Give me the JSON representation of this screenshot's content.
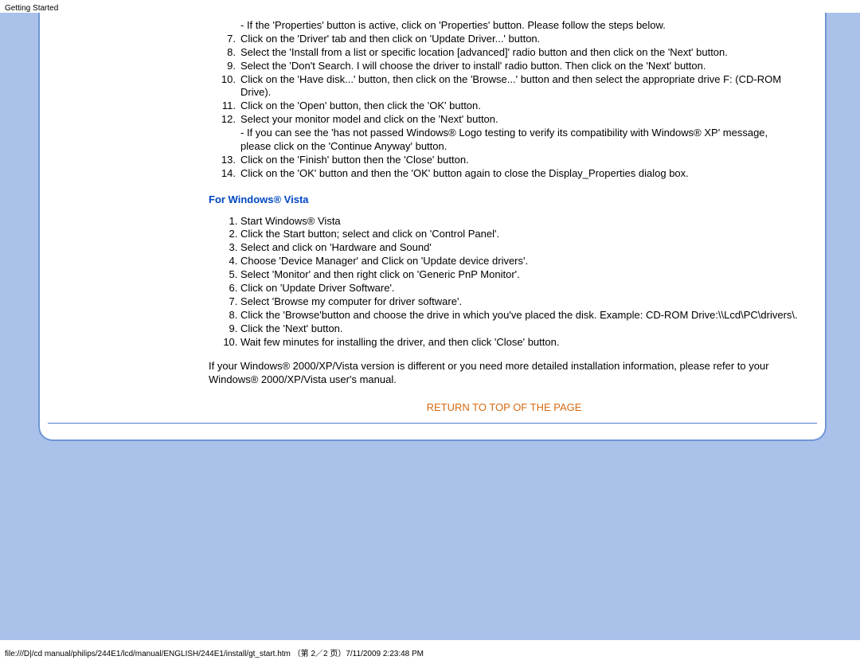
{
  "browser_title": "Getting Started",
  "xp_continue": [
    {
      "n": "",
      "txt": "- If the 'Properties' button is active, click on 'Properties' button. Please follow the steps below."
    },
    {
      "n": "7.",
      "txt": "Click on the 'Driver' tab and then click on 'Update Driver...' button."
    },
    {
      "n": "8.",
      "txt": "Select the 'Install from a list or specific location [advanced]' radio button and then click on the 'Next' button."
    },
    {
      "n": "9.",
      "txt": "Select the 'Don't Search. I will choose the driver to install' radio button. Then click on the 'Next' button."
    },
    {
      "n": "10.",
      "txt": "Click on the 'Have disk...' button, then click on the 'Browse...' button and then select the appropriate drive F: (CD-ROM Drive)."
    },
    {
      "n": "11.",
      "txt": "Click on the 'Open' button, then click the 'OK' button."
    },
    {
      "n": "12.",
      "txt": "Select your monitor model and click on the 'Next' button."
    },
    {
      "n": "",
      "txt": "- If you can see the 'has not passed Windows® Logo testing to verify its compatibility with Windows® XP' message, please click on the 'Continue Anyway' button."
    },
    {
      "n": "13.",
      "txt": "Click on the 'Finish' button then the 'Close' button."
    },
    {
      "n": "14.",
      "txt": "Click on the 'OK' button and then the 'OK' button again to close the Display_Properties dialog box."
    }
  ],
  "vista_heading": "For Windows® Vista",
  "vista_steps": [
    "Start Windows® Vista",
    "Click the Start button; select and click on 'Control Panel'.",
    "Select and click on 'Hardware and Sound'",
    "Choose 'Device Manager' and Click on 'Update device drivers'.",
    "Select 'Monitor' and then right click on 'Generic PnP Monitor'.",
    "Click on 'Update Driver Software'.",
    "Select 'Browse my computer for driver software'.",
    "Click the 'Browse'button and choose the drive in which you've placed the disk. Example: CD-ROM Drive:\\\\Lcd\\PC\\drivers\\.",
    "Click the 'Next' button.",
    "Wait few minutes for installing the driver, and then click 'Close' button."
  ],
  "closing_note": "If your Windows® 2000/XP/Vista version is different or you need more detailed installation information, please refer to your Windows® 2000/XP/Vista user's manual.",
  "return_label": "RETURN TO TOP OF THE PAGE",
  "footer_path": "file:///D|/cd manual/philips/244E1/lcd/manual/ENGLISH/244E1/install/gt_start.htm （第 2／2 页）7/11/2009 2:23:48 PM"
}
